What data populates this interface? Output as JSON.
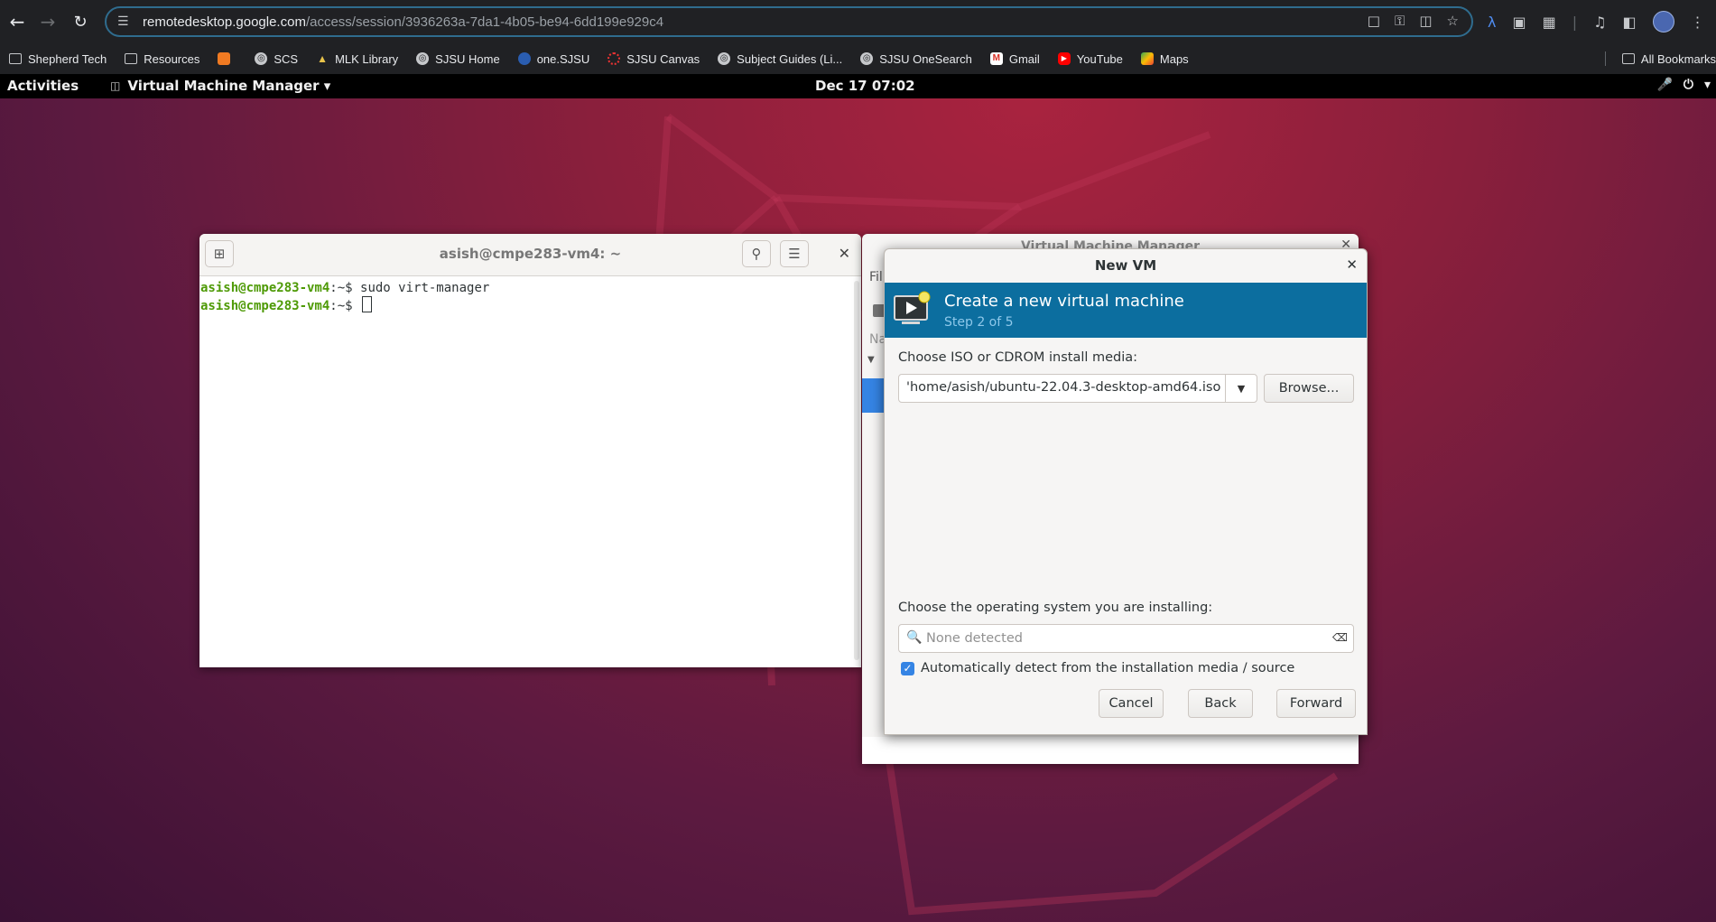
{
  "browser": {
    "url_host": "remotedesktop.google.com",
    "url_path": "/access/session/3936263a-7da1-4b05-be94-6dd199e929c4",
    "bookmarks": [
      {
        "label": "Shepherd Tech",
        "icon": "folder-icon"
      },
      {
        "label": "Resources",
        "icon": "folder-icon"
      },
      {
        "label": "",
        "icon": "orange-app-icon"
      },
      {
        "label": "SCS",
        "icon": "globe-icon"
      },
      {
        "label": "MLK Library",
        "icon": "library-icon"
      },
      {
        "label": "SJSU Home",
        "icon": "globe-icon"
      },
      {
        "label": "one.SJSU",
        "icon": "sjsu-icon"
      },
      {
        "label": "SJSU Canvas",
        "icon": "canvas-icon"
      },
      {
        "label": "Subject Guides (Li...",
        "icon": "globe-icon"
      },
      {
        "label": "SJSU OneSearch",
        "icon": "globe-icon"
      },
      {
        "label": "Gmail",
        "icon": "gmail-icon"
      },
      {
        "label": "YouTube",
        "icon": "youtube-icon"
      },
      {
        "label": "Maps",
        "icon": "maps-icon"
      }
    ],
    "all_bookmarks": "All Bookmarks"
  },
  "gnome": {
    "activities": "Activities",
    "app_name": "Virtual Machine Manager ▾",
    "clock": "Dec 17  07:02"
  },
  "terminal": {
    "title": "asish@cmpe283-vm4: ~",
    "lines": [
      {
        "prompt": "asish@cmpe283-vm4",
        "suffix": ":~$ ",
        "command": "sudo virt-manager"
      },
      {
        "prompt": "asish@cmpe283-vm4",
        "suffix": ":~$ ",
        "command": ""
      }
    ]
  },
  "vmm": {
    "title": "Virtual Machine Manager",
    "menu_fragment": "Fil",
    "name_fragment": "Na"
  },
  "newvm": {
    "title": "New VM",
    "banner_title": "Create a new virtual machine",
    "banner_step": "Step 2 of 5",
    "iso_label": "Choose ISO or CDROM install media:",
    "iso_value": "'home/asish/ubuntu-22.04.3-desktop-amd64.iso",
    "browse_label": "Browse...",
    "os_label": "Choose the operating system you are installing:",
    "os_placeholder": "None detected",
    "auto_detect_label": "Automatically detect from the installation media / source",
    "auto_detect_checked": true,
    "cancel_label": "Cancel",
    "back_label": "Back",
    "forward_label": "Forward"
  },
  "colors": {
    "banner": "#0c6e9f",
    "prompt_green": "#4e9a06",
    "checkbox_blue": "#3584e4"
  }
}
